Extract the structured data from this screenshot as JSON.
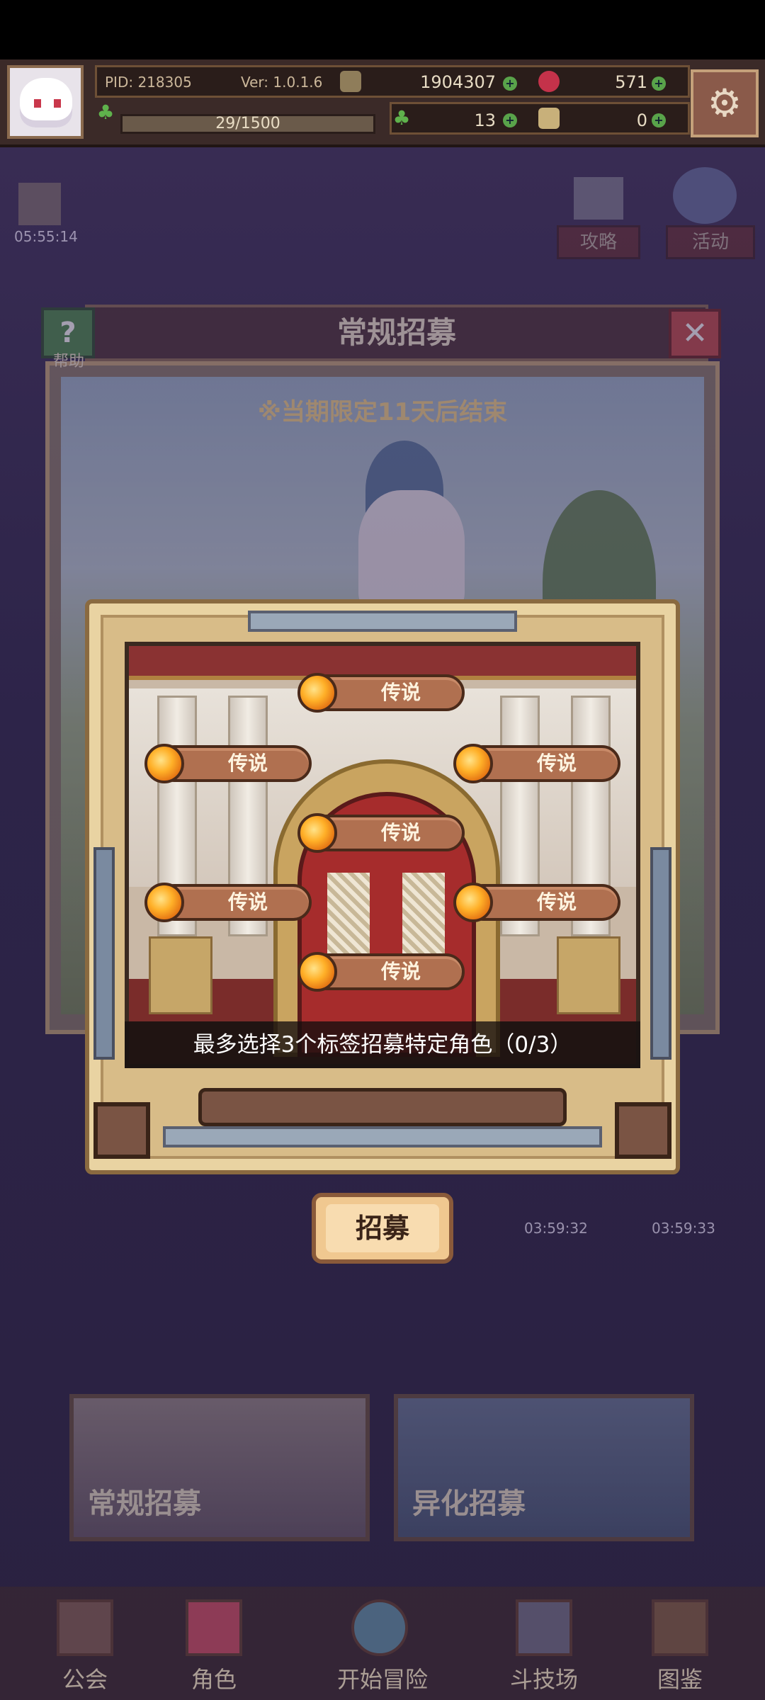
{
  "hud": {
    "pid": "PID: 218305",
    "version": "Ver: 1.0.1.6",
    "coins": "1904307",
    "gems": "571",
    "exp": "29/1500",
    "clover": "13",
    "tickets": "0"
  },
  "side": {
    "timer": "05:55:14",
    "guide": "攻略",
    "event": "活动"
  },
  "recruit_dialog": {
    "title": "常规招募",
    "help_label": "帮助",
    "notice": "※当期限定11天后结束",
    "timers": [
      "03:59:32",
      "03:59:33"
    ]
  },
  "tag_modal": {
    "tags": [
      "传说",
      "传说",
      "传说",
      "传说",
      "传说",
      "传说",
      "传说"
    ],
    "hint": "最多选择3个标签招募特定角色（0/3）",
    "recruit_button": "招募"
  },
  "pool_tabs": {
    "regular": "常规招募",
    "alien": "异化招募"
  },
  "nav": {
    "items": [
      {
        "label": "公会"
      },
      {
        "label": "角色"
      },
      {
        "label": "开始冒险"
      },
      {
        "label": "斗技场"
      },
      {
        "label": "图鉴"
      }
    ]
  },
  "colors": {
    "gold_frame": "#e9d3a2",
    "tag_pill": "#b07050",
    "tag_gem": "#ffb028",
    "door_red": "#a62c2c"
  }
}
